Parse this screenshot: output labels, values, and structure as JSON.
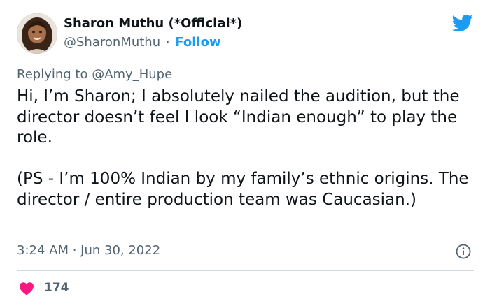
{
  "author": {
    "display_name": "Sharon Muthu (*Official*)",
    "handle": "@SharonMuthu",
    "separator": "·",
    "follow_label": "Follow",
    "avatar_icon": "profile-photo"
  },
  "reply": {
    "prefix": "Replying to ",
    "mention": "@Amy_Hupe"
  },
  "tweet": {
    "text": "Hi, I’m Sharon; I absolutely nailed the audition, but the director doesn’t feel I look “Indian enough” to play the role.\n\n(PS - I’m 100% Indian by my family’s ethnic origins. The director / entire production team was Caucasian.)",
    "timestamp": "3:24 AM · Jun 30, 2022"
  },
  "engagement": {
    "likes": "174",
    "like_icon": "heart-icon",
    "info_icon": "info-icon"
  },
  "colors": {
    "accent": "#1d9bf0",
    "heart": "#f91880",
    "secondary_text": "#536471",
    "primary_text": "#0f1419"
  }
}
